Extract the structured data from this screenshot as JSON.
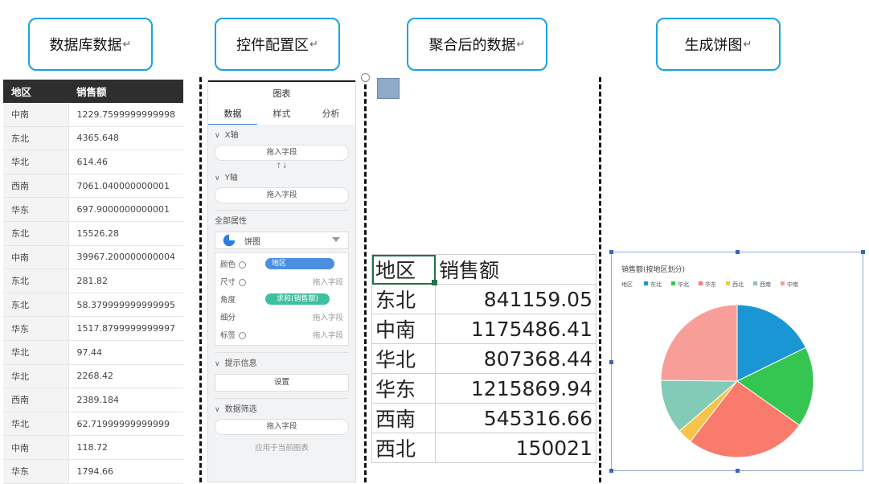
{
  "callouts": [
    {
      "label": "数据库数据",
      "mark": "↵"
    },
    {
      "label": "控件配置区",
      "mark": "↵"
    },
    {
      "label": "聚合后的数据",
      "mark": "↵"
    },
    {
      "label": "生成饼图",
      "mark": "↵"
    }
  ],
  "db_table": {
    "headers": [
      "地区",
      "销售额"
    ],
    "rows": [
      [
        "中南",
        "1229.7599999999998"
      ],
      [
        "东北",
        "4365.648"
      ],
      [
        "华北",
        "614.46"
      ],
      [
        "西南",
        "7061.040000000001"
      ],
      [
        "华东",
        "697.9000000000001"
      ],
      [
        "东北",
        "15526.28"
      ],
      [
        "中南",
        "39967.200000000004"
      ],
      [
        "东北",
        "281.82"
      ],
      [
        "东北",
        "58.379999999999995"
      ],
      [
        "华东",
        "1517.8799999999997"
      ],
      [
        "华北",
        "97.44"
      ],
      [
        "华北",
        "2268.42"
      ],
      [
        "西南",
        "2389.184"
      ],
      [
        "华北",
        "62.71999999999999"
      ],
      [
        "中南",
        "118.72"
      ],
      [
        "华东",
        "1794.66"
      ]
    ]
  },
  "config": {
    "title": "图表",
    "tabs": [
      "数据",
      "样式",
      "分析"
    ],
    "x_axis": {
      "label": "X轴",
      "placeholder": "拖入字段"
    },
    "swap": "↑↓",
    "y_axis": {
      "label": "Y轴",
      "placeholder": "拖入字段"
    },
    "all_props": "全部属性",
    "chart_type": "饼图",
    "props": [
      {
        "label": "颜色",
        "value": "地区",
        "kind": "blue",
        "eye": true
      },
      {
        "label": "尺寸",
        "value": "拖入字段",
        "kind": "text",
        "eye": true
      },
      {
        "label": "角度",
        "value": "求和(销售额)",
        "kind": "green",
        "eye": false
      },
      {
        "label": "细分",
        "value": "拖入字段",
        "kind": "text",
        "eye": false
      },
      {
        "label": "标签",
        "value": "拖入字段",
        "kind": "text",
        "eye": true
      }
    ],
    "tooltip": {
      "label": "提示信息",
      "button": "设置"
    },
    "filter": {
      "label": "数据筛选",
      "placeholder": "拖入字段",
      "note": "应用于当前图表"
    }
  },
  "agg_table": {
    "headers": [
      "地区",
      "销售额"
    ],
    "rows": [
      [
        "东北",
        "841159.05"
      ],
      [
        "中南",
        "1175486.41"
      ],
      [
        "华北",
        "807368.44"
      ],
      [
        "华东",
        "1215869.94"
      ],
      [
        "西南",
        "545316.66"
      ],
      [
        "西北",
        "150021"
      ]
    ]
  },
  "chart_data": {
    "type": "pie",
    "title": "销售额(按地区划分)",
    "legend_title": "地区",
    "legend_position": "top-left",
    "categories": [
      "东北",
      "华北",
      "华东",
      "西北",
      "西南",
      "中南"
    ],
    "values": [
      841159.05,
      807368.44,
      1215869.94,
      150021,
      545316.66,
      1175486.41
    ],
    "colors": [
      "#1a96d4",
      "#34c651",
      "#f97b6b",
      "#f8c34a",
      "#82cbb6",
      "#f79e98"
    ]
  }
}
